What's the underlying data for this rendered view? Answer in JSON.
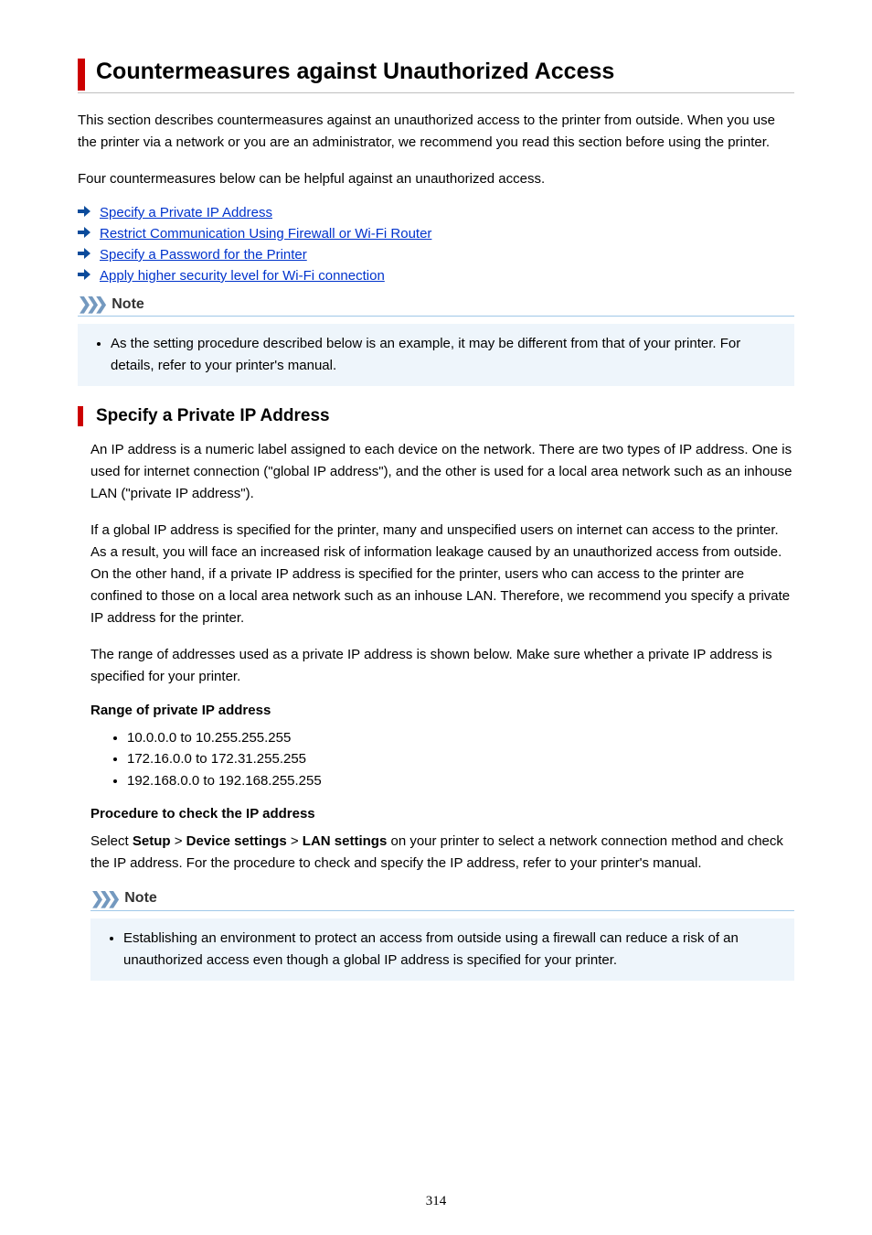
{
  "title": "Countermeasures against Unauthorized Access",
  "intro1": "This section describes countermeasures against an unauthorized access to the printer from outside. When you use the printer via a network or you are an administrator, we recommend you read this section before using the printer.",
  "intro2": "Four countermeasures below can be helpful against an unauthorized access.",
  "links": {
    "l1": "Specify a Private IP Address",
    "l2": "Restrict Communication Using Firewall or Wi-Fi Router",
    "l3": "Specify a Password for the Printer",
    "l4": "Apply higher security level for Wi-Fi connection"
  },
  "note1": {
    "label": "Note",
    "item": "As the setting procedure described below is an example, it may be different from that of your printer. For details, refer to your printer's manual."
  },
  "section1": {
    "heading": "Specify a Private IP Address",
    "p1": "An IP address is a numeric label assigned to each device on the network. There are two types of IP address. One is used for internet connection (\"global IP address\"), and the other is used for a local area network such as an inhouse LAN (\"private IP address\").",
    "p2": "If a global IP address is specified for the printer, many and unspecified users on internet can access to the printer. As a result, you will face an increased risk of information leakage caused by an unauthorized access from outside. On the other hand, if a private IP address is specified for the printer, users who can access to the printer are confined to those on a local area network such as an inhouse LAN. Therefore, we recommend you specify a private IP address for the printer.",
    "p3": "The range of addresses used as a private IP address is shown below. Make sure whether a private IP address is specified for your printer.",
    "rangeHeading": "Range of private IP address",
    "ranges": {
      "r1": "10.0.0.0 to 10.255.255.255",
      "r2": "172.16.0.0 to 172.31.255.255",
      "r3": "192.168.0.0 to 192.168.255.255"
    },
    "procHeading": "Procedure to check the IP address",
    "procPrefix": "Select ",
    "setup": "Setup",
    "gt1": " > ",
    "device": "Device settings",
    "gt2": " > ",
    "lan": "LAN settings",
    "procSuffix": " on your printer to select a network connection method and check the IP address. For the procedure to check and specify the IP address, refer to your printer's manual."
  },
  "note2": {
    "label": "Note",
    "item": "Establishing an environment to protect an access from outside using a firewall can reduce a risk of an unauthorized access even though a global IP address is specified for your printer."
  },
  "pageNumber": "314"
}
